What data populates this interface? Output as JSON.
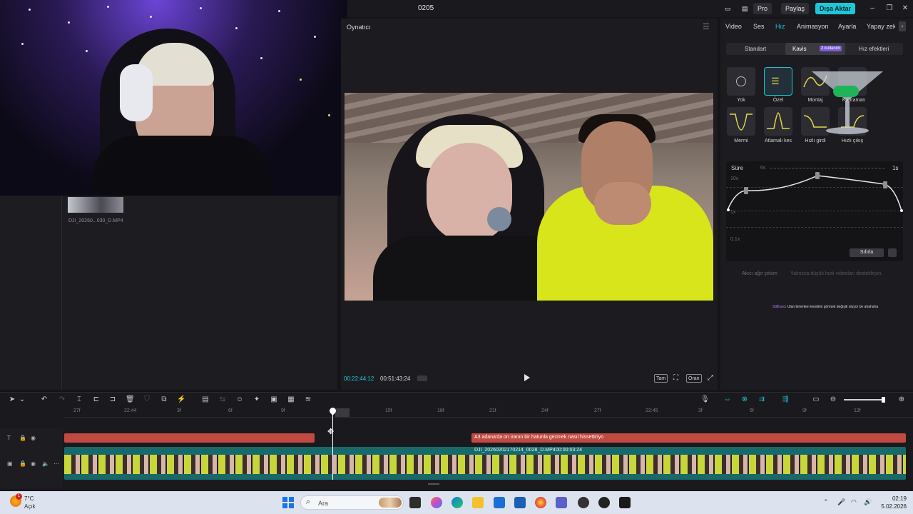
{
  "app": {
    "project_title": "0205",
    "buttons": {
      "pro": "Pro",
      "share": "Paylaş",
      "export": "Dışa Aktar"
    }
  },
  "media": {
    "filename": "DJI_20260...030_D.MP4"
  },
  "player": {
    "title": "Oynatıcı",
    "timecode_current": "00:22:44:12",
    "timecode_total": "00:51:43:24",
    "controls": {
      "full": "Tam",
      "ratio": "Oran"
    }
  },
  "right_panel": {
    "tabs": [
      "Video",
      "Ses",
      "Hız",
      "Animasyon",
      "Ayarla",
      "Yapay zekâ"
    ],
    "active_tab": "Hız",
    "subtabs": [
      "Standart",
      "Kavis",
      "Hız efektleri"
    ],
    "usage_badge": "2 kullanım",
    "presets": [
      "Yok",
      "Özel",
      "Montaj",
      "Kahraman",
      "Mermi",
      "Atlamalı kes",
      "Hızlı girdi",
      "Hızlı çıkış"
    ],
    "curve": {
      "duration_label": "Süre",
      "duration_min": "6s",
      "duration_max": "1s",
      "y_labels": [
        "10x",
        "1x",
        "0.1x"
      ],
      "reset_label": "Sıfırla"
    },
    "smooth_text": "Akıcı ağır çekim",
    "smooth_info": "Yalnızca düşük hızlı videoları destekleyin.",
    "caption_preview_tag": "Stilfrancı",
    "caption_preview_text": "Ulan birlerken kendimi görmek değişik oluyor be ahahaha"
  },
  "timeline": {
    "ruler_ticks": [
      "27f",
      "22:44",
      "3f",
      "6f",
      "9f",
      "12f",
      "15f",
      "18f",
      "21f",
      "24f",
      "27f",
      "22:45",
      "3f",
      "6f",
      "9f",
      "12f"
    ],
    "text_clip_label": "A3 adana'da on iranın bir hatunla gezmek nasıl hissettiriyo",
    "video_clip_name": "DJI_20260202170214_0028_D.MP4",
    "video_clip_duration": "00:00:03:24"
  },
  "taskbar": {
    "weather_badge": "1",
    "weather_temp": "7°C",
    "weather_desc": "Açık",
    "search_label": "Ara",
    "clock_time": "02:19",
    "clock_date": "5.02.2026"
  },
  "colors": {
    "accent": "#1ec6d8",
    "text_clip": "#c04a42",
    "video_clip": "#186a6a",
    "badge": "#7d5bd6"
  }
}
